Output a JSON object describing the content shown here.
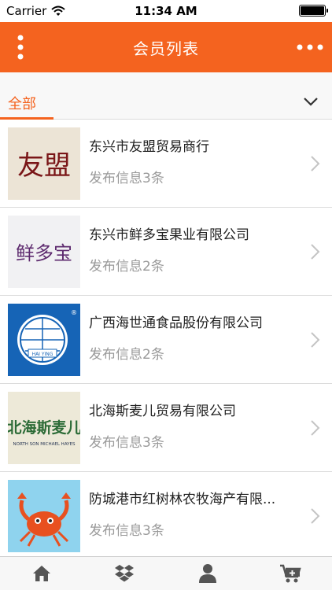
{
  "status_bar": {
    "carrier": "Carrier",
    "time": "11:34 AM",
    "wifi_icon": "wifi-icon",
    "battery_icon": "battery-icon"
  },
  "nav": {
    "title": "会员列表",
    "left_icon": "vertical-dots-icon",
    "right_icon": "horizontal-dots-icon",
    "background": "#f4631f"
  },
  "filter": {
    "active_tab": "全部",
    "toggle_icon": "chevron-down-icon",
    "accent": "#f4631f"
  },
  "members": [
    {
      "name": "东兴市友盟贸易商行",
      "posts": "发布信息3条",
      "logo_text": "友盟"
    },
    {
      "name": "东兴市鲜多宝果业有限公司",
      "posts": "发布信息2条",
      "logo_text": "鲜多宝"
    },
    {
      "name": "广西海世通食品股份有限公司",
      "posts": "发布信息2条",
      "logo_text": "HAI YING"
    },
    {
      "name": "北海斯麦儿贸易有限公司",
      "posts": "发布信息3条",
      "logo_text": "北海斯麦儿",
      "logo_subtext": "NORTH SON MICHAEL HAYES"
    },
    {
      "name": "防城港市红树林农牧海产有限...",
      "posts": "发布信息3条",
      "logo_text": ""
    }
  ],
  "tab_bar": {
    "items": [
      "home-icon",
      "dropbox-icon",
      "user-icon",
      "cart-add-icon"
    ]
  }
}
